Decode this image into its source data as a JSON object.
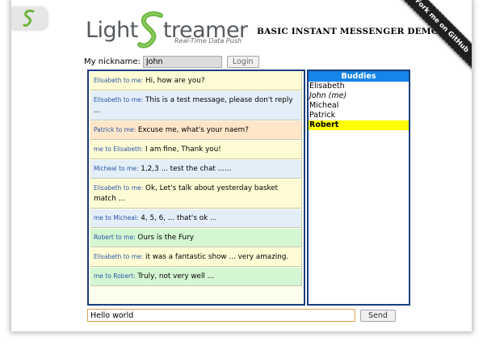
{
  "header": {
    "logo_text_left": "Light",
    "logo_text_right": "treamer",
    "logo_tagline": "Real-Time Data Push",
    "demo_title": "BASIC INSTANT MESSENGER DEMO",
    "ribbon": "Fork me on GitHub"
  },
  "nickname": {
    "label": "My nickname:",
    "value": "John",
    "login_label": "Login"
  },
  "messages": [
    {
      "from": "Elisabeth to me:",
      "text": "Hi, how are you?",
      "color": "yellow"
    },
    {
      "from": "Elisabeth to me:",
      "text": "This is a test message, please don't reply ...",
      "color": "blue"
    },
    {
      "from": "Patrick to me:",
      "text": "Excuse me, what's your naem?",
      "color": "orange"
    },
    {
      "from": "me to Elisabeth:",
      "text": "I am fine, Thank you!",
      "color": "yellow"
    },
    {
      "from": "Micheal to me:",
      "text": "1,2,3 ... test the chat ......",
      "color": "blue"
    },
    {
      "from": "Elisabeth to me:",
      "text": "Ok, Let's talk about yesterday basket match ...",
      "color": "yellow"
    },
    {
      "from": "me to Micheal:",
      "text": "4, 5, 6, ... that's ok ...",
      "color": "blue"
    },
    {
      "from": "Robert to me:",
      "text": "Ours is the Fury",
      "color": "green"
    },
    {
      "from": "Elisabeth to me:",
      "text": "it was a fantastic show ... very amazing.",
      "color": "yellow"
    },
    {
      "from": "me to Robert:",
      "text": "Truly, not very well ...",
      "color": "green"
    }
  ],
  "buddies": {
    "header": "Buddies",
    "items": [
      {
        "name": "Elisabeth",
        "style": ""
      },
      {
        "name": "John (me)",
        "style": "me"
      },
      {
        "name": "Micheal",
        "style": ""
      },
      {
        "name": "Patrick",
        "style": ""
      },
      {
        "name": "Robert",
        "style": "selected"
      }
    ]
  },
  "compose": {
    "value": "Hello world",
    "send_label": "Send"
  },
  "colors": {
    "panel_border": "#1b3f7d",
    "buddies_header": "#1585e9",
    "selected_buddy": "#ffff00",
    "logo_green": "#6cb43f"
  }
}
